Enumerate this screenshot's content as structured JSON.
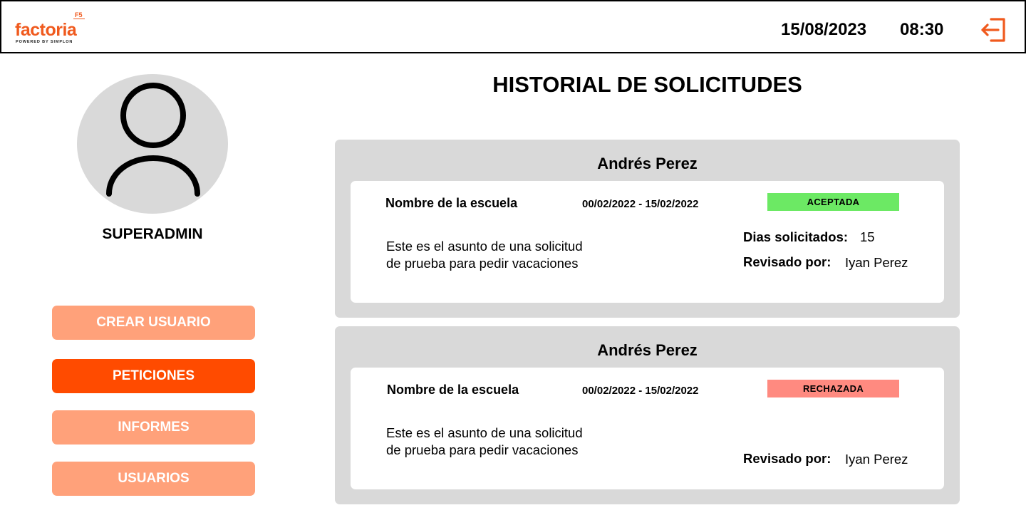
{
  "header": {
    "logo": {
      "name": "factoria",
      "badge": "F5",
      "tagline": "POWERED BY SIMPLON"
    },
    "date": "15/08/2023",
    "time": "08:30",
    "logout_icon": "logout-icon",
    "accent_color": "#f05a1e"
  },
  "profile": {
    "avatar_icon": "user-icon",
    "role": "SUPERADMIN"
  },
  "nav": {
    "items": [
      {
        "label": "CREAR USUARIO",
        "active": false
      },
      {
        "label": "PETICIONES",
        "active": true
      },
      {
        "label": "INFORMES",
        "active": false
      },
      {
        "label": "USUARIOS",
        "active": false
      }
    ],
    "active_color": "#ff4b00",
    "inactive_color": "#ffa17a"
  },
  "main": {
    "title": "HISTORIAL DE SOLICITUDES",
    "requests": [
      {
        "name": "Andrés Perez",
        "school": "Nombre de la escuela",
        "dates": "00/02/2022 - 15/02/2022",
        "status": "ACEPTADA",
        "status_color": "#6ce964",
        "subject_line1": "Este es el asunto de una solicitud",
        "subject_line2": "de prueba para pedir vacaciones",
        "days_label": "Dias solicitados:",
        "days_value": "15",
        "reviewed_label": "Revisado por:",
        "reviewed_value": "Iyan Perez"
      },
      {
        "name": "Andrés Perez",
        "school": "Nombre de la escuela",
        "dates": "00/02/2022 - 15/02/2022",
        "status": "RECHAZADA",
        "status_color": "#ff8a80",
        "subject_line1": "Este es el asunto de una solicitud",
        "subject_line2": "de prueba para pedir vacaciones",
        "reviewed_label": "Revisado por:",
        "reviewed_value": "Iyan Perez"
      }
    ]
  }
}
